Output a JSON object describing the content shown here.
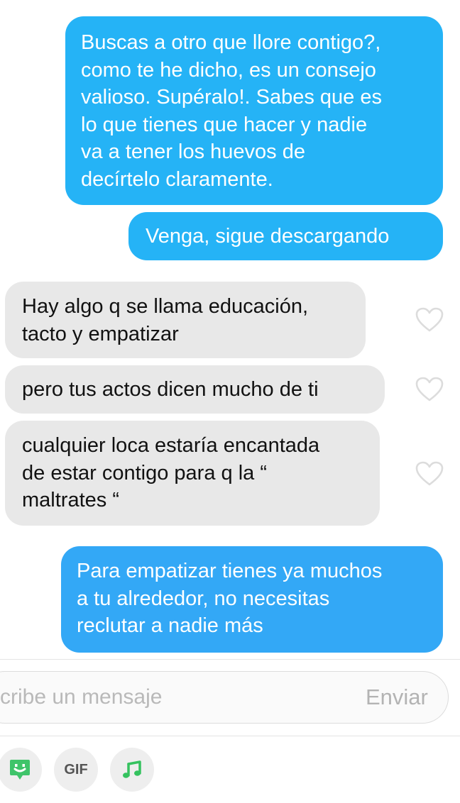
{
  "messages": [
    {
      "direction": "sent",
      "text": "Buscas a otro que llore contigo?,\ncomo te he dicho, es un consejo\nvalioso. Supéralo!. Sabes que es\nlo que tienes que hacer y nadie\nva a tener los huevos de\ndecírtelo claramente."
    },
    {
      "direction": "sent",
      "text": "Venga, sigue descargando"
    },
    {
      "direction": "received",
      "text": "Hay algo q se llama educación,\ntacto y empatizar"
    },
    {
      "direction": "received",
      "text": "pero tus actos dicen mucho de ti"
    },
    {
      "direction": "received",
      "text": "cualquier loca estaría encantada\nde estar contigo para q la “\nmaltrates “"
    },
    {
      "direction": "sent",
      "text": "Para empatizar tienes ya muchos\na tu alrededor, no necesitas\nreclutar a nadie más"
    }
  ],
  "composer": {
    "placeholder": "cribe un mensaje",
    "send_label": "Enviar"
  },
  "toolbar": {
    "gif_label": "GIF",
    "icons": [
      "sticker-icon",
      "gif-icon",
      "music-icon"
    ]
  },
  "colors": {
    "sent_bubble": "#25b3f6",
    "received_bubble": "#e8e8e8",
    "sticker_green": "#3fc46a",
    "music_green": "#35c25f"
  }
}
